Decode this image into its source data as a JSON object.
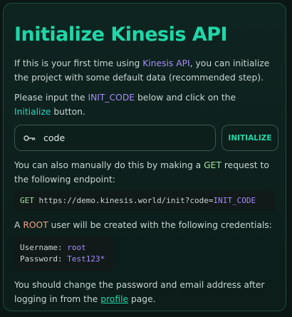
{
  "title": "Initialize Kinesis API",
  "intro": {
    "pre": "If this is your first time using ",
    "app_name": "Kinesis API",
    "post": ", you can initialize the project with some default data (recommended step)."
  },
  "instruction": {
    "pre": "Please input the ",
    "code_name": "INIT_CODE",
    "mid": " below and click on the ",
    "button_ref": "Initialize",
    "post": " button."
  },
  "form": {
    "input_value": "code",
    "input_placeholder": "",
    "button_label": "INITIALIZE"
  },
  "manual": {
    "pre": "You can also manually do this by making a ",
    "method": "GET",
    "post": " request to the following endpoint:"
  },
  "endpoint": {
    "method": "GET",
    "url": "https://demo.kinesis.world/init?code=",
    "param": "INIT_CODE"
  },
  "root_user": {
    "pre": "A ",
    "role": "ROOT",
    "post": " user will be created with the following credentials:"
  },
  "credentials": {
    "username_label": "Username:",
    "username": "root",
    "password_label": "Password:",
    "password": "Test123*"
  },
  "footer": {
    "pre": "You should change the password and email address after logging in from the ",
    "link": "profile",
    "post": " page."
  },
  "colors": {
    "accent": "#1fd7a8",
    "purple": "#a78bfa",
    "green": "#9fe59a",
    "orange": "#f6a28a"
  },
  "icons": {
    "input_icon": "key-icon"
  }
}
